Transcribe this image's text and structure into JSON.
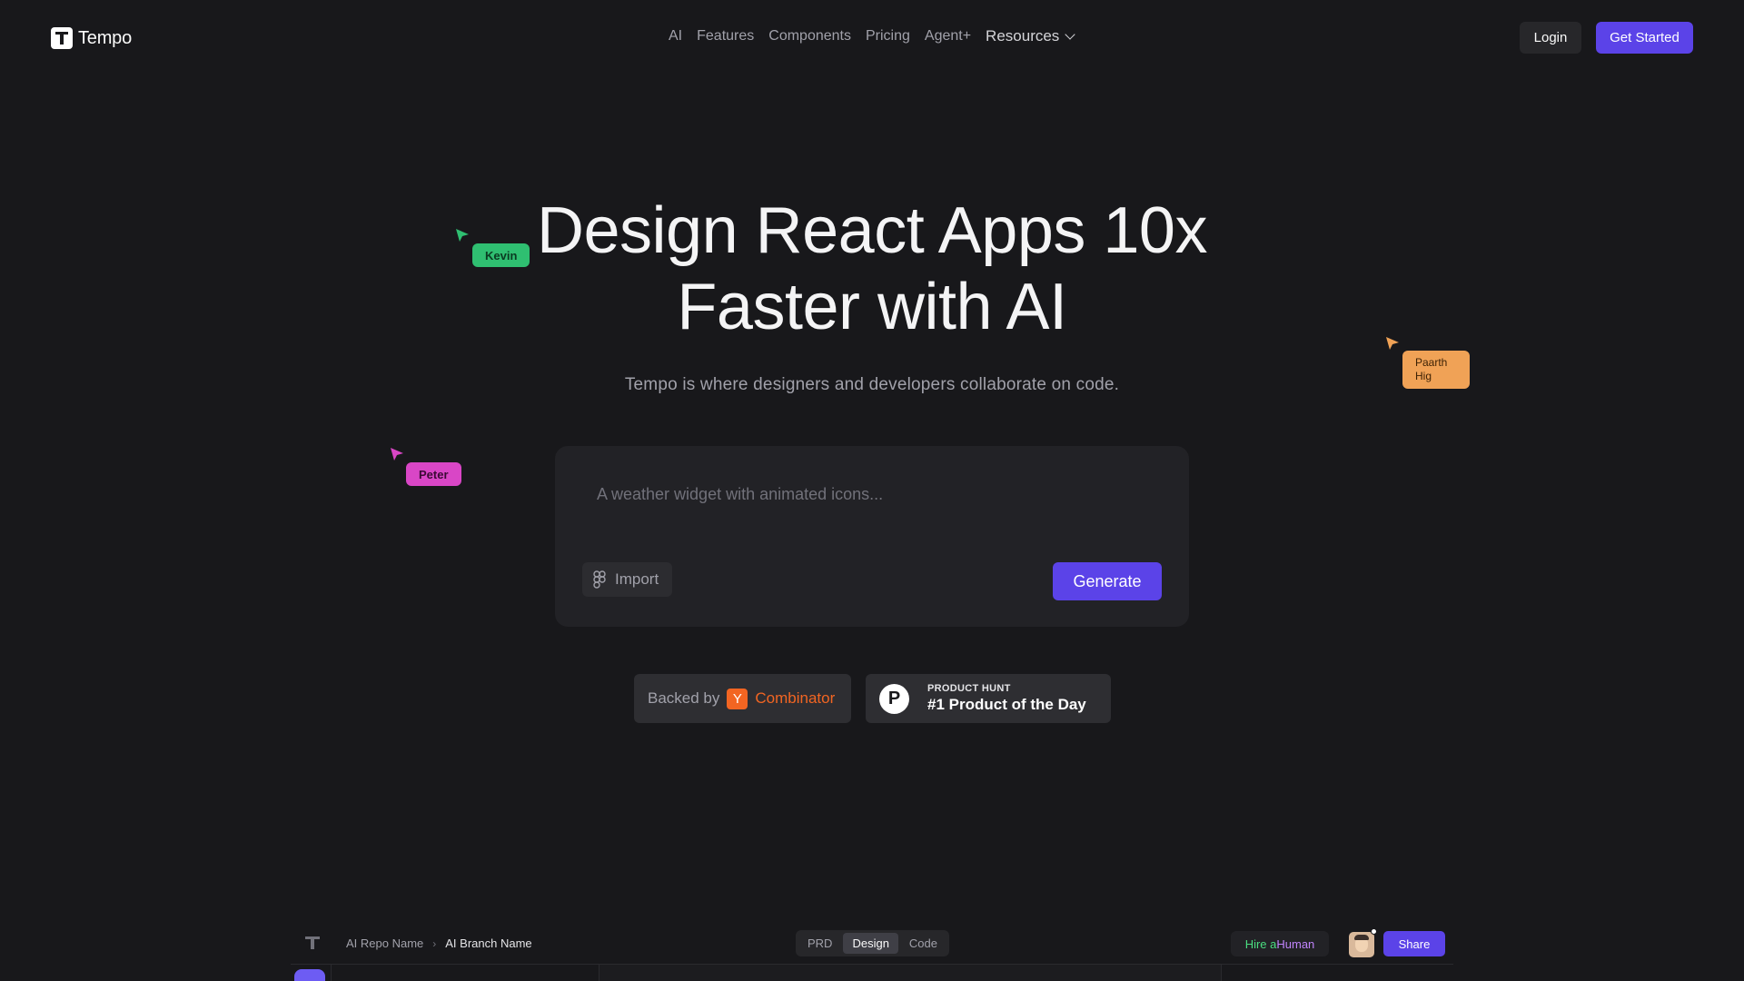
{
  "brand": {
    "name": "Tempo"
  },
  "nav": {
    "links": [
      "AI",
      "Features",
      "Components",
      "Pricing",
      "Agent+"
    ],
    "resources_label": "Resources",
    "login_label": "Login",
    "get_started_label": "Get Started"
  },
  "hero": {
    "title_line1": "Design React Apps 10x",
    "title_line2": "Faster with AI",
    "subtitle": "Tempo is where designers and developers collaborate on code."
  },
  "cursors": {
    "kevin": {
      "name": "Kevin",
      "color": "#2fbf71"
    },
    "peter": {
      "name": "Peter",
      "color": "#d946c6"
    },
    "paarth": {
      "name_line1": "Paarth",
      "name_line2": "Hig",
      "color": "#f0a256"
    }
  },
  "prompt": {
    "placeholder": "A weather widget with animated icons...",
    "import_label": "Import",
    "generate_label": "Generate"
  },
  "badges": {
    "yc_prefix": "Backed by",
    "yc_letter": "Y",
    "yc_name": "Combinator",
    "ph_letter": "P",
    "ph_small": "PRODUCT HUNT",
    "ph_big": "#1 Product of the Day"
  },
  "editor": {
    "repo": "AI Repo Name",
    "branch": "AI Branch Name",
    "tabs": [
      "PRD",
      "Design",
      "Code"
    ],
    "active_tab": "Design",
    "hire_part1": "Hire a ",
    "hire_part2": "Human",
    "share_label": "Share"
  },
  "colors": {
    "background": "#18181b",
    "accent": "#5b43e8",
    "yc_orange": "#f26522"
  }
}
